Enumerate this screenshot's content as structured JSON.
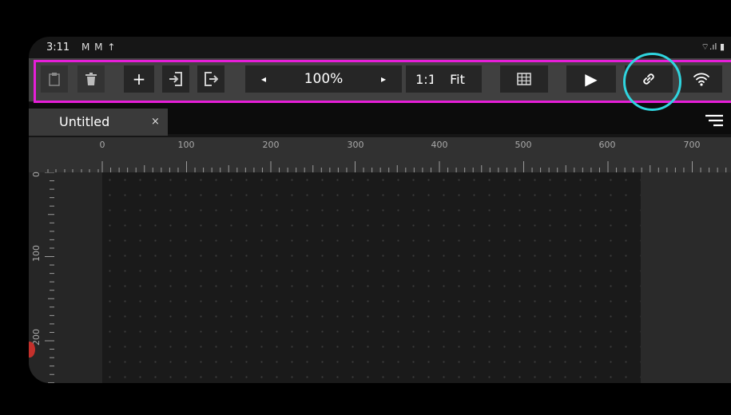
{
  "status_bar": {
    "time": "3:11",
    "notification_icons": [
      "gmail-icon",
      "gmail-icon",
      "upload-icon"
    ],
    "notification_glyphs": "M M ↑",
    "system_icons_text": "⌔.ıl ▮"
  },
  "toolbar": {
    "paste_label": "paste",
    "delete_label": "delete",
    "add_label": "+",
    "zoom_out_label": "◂",
    "zoom_value": "100%",
    "zoom_in_label": "▸",
    "actual_size_label": "1:1",
    "fit_label": "Fit",
    "play_label": "▶"
  },
  "tabs": [
    {
      "label": "Untitled",
      "close": "×"
    }
  ],
  "rulers": {
    "horizontal": [
      "0",
      "100",
      "200",
      "300",
      "400",
      "500",
      "600",
      "700"
    ],
    "vertical": [
      "0",
      "100",
      "200"
    ]
  },
  "colors": {
    "highlight_rect": "#e61ed8",
    "highlight_circle": "#2fd5df",
    "toolbar_bg": "#404040",
    "button_bg": "#262626"
  }
}
